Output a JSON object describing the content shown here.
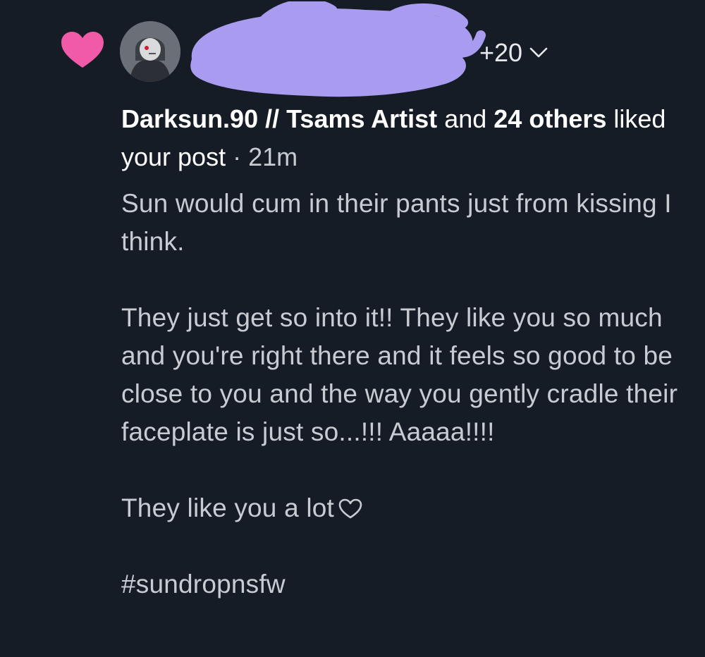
{
  "notification": {
    "type_icon": "heart-icon",
    "type_icon_color": "#f05aa6",
    "avatar_icon": "user-avatar",
    "redaction_color": "#a99cf0",
    "more_avatars_label": "+20",
    "more_avatars_chevron": "chevron-down-icon",
    "headline": {
      "actor_name": "Darksun.90 // Tsams Artist",
      "and_word": "and",
      "others_count": "24",
      "others_word": "others",
      "action_text": "liked your post",
      "separator": "·",
      "time_ago": "21m"
    },
    "post": {
      "paragraph_1": "Sun would cum in their pants just from kissing I think.",
      "paragraph_2": "They just get so into it!! They like you so much and you're right there and it feels so good to be close to you and the way you gently cradle their faceplate is just so...!!! Aaaaa!!!!",
      "paragraph_3": "They like you a lot",
      "paragraph_3_icon": "heart-outline-icon",
      "hashtag": "#sundropnsfw"
    }
  },
  "colors": {
    "background": "#161c25",
    "primary_text": "#ffffff",
    "secondary_text": "#c8ccd2"
  }
}
